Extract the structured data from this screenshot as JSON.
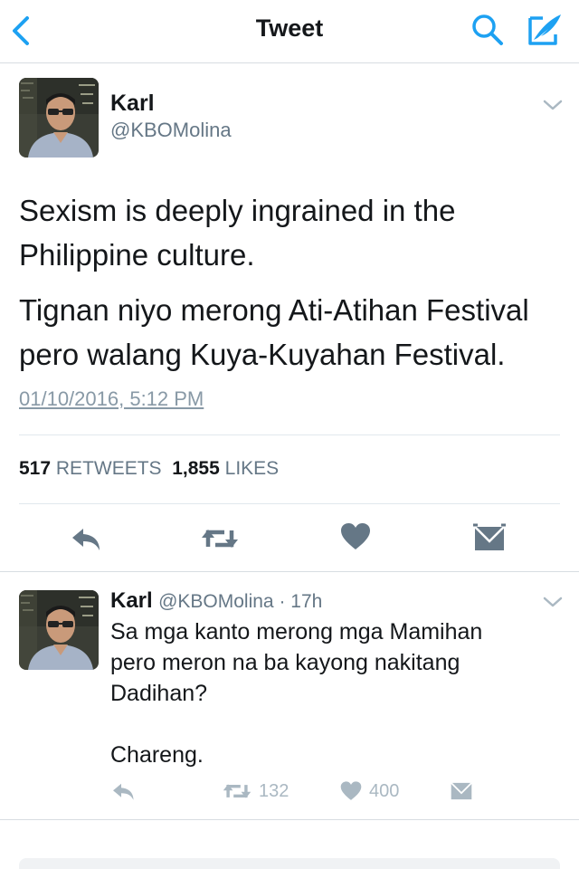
{
  "navbar": {
    "title": "Tweet",
    "back_icon": "chevron-left-icon",
    "search_icon": "search-icon",
    "compose_icon": "compose-feather-icon",
    "accent_color": "#1da1f2"
  },
  "main_tweet": {
    "name": "Karl",
    "handle": "@KBOMolina",
    "paragraphs": [
      "Sexism is deeply ingrained in the Philippine culture.",
      "Tignan niyo merong Ati-Atihan Festival pero walang Kuya-Kuyahan Festival."
    ],
    "timestamp": "01/10/2016, 5:12 PM",
    "retweets_count": "517",
    "retweets_label": "RETWEETS",
    "likes_count": "1,855",
    "likes_label": "LIKES",
    "actions": [
      "reply-icon",
      "retweet-icon",
      "heart-icon",
      "direct-message-icon"
    ]
  },
  "reply_tweet": {
    "name": "Karl",
    "meta": "@KBOMolina · 17h",
    "text": "Sa mga kanto merong mga Mamihan\npero meron na ba kayong nakitang\nDadihan?\n\nChareng.",
    "retweet_count": "132",
    "like_count": "400"
  },
  "colors": {
    "icon_gray": "#657786",
    "light_icon_gray": "#aab8c2",
    "text": "#14171a"
  }
}
